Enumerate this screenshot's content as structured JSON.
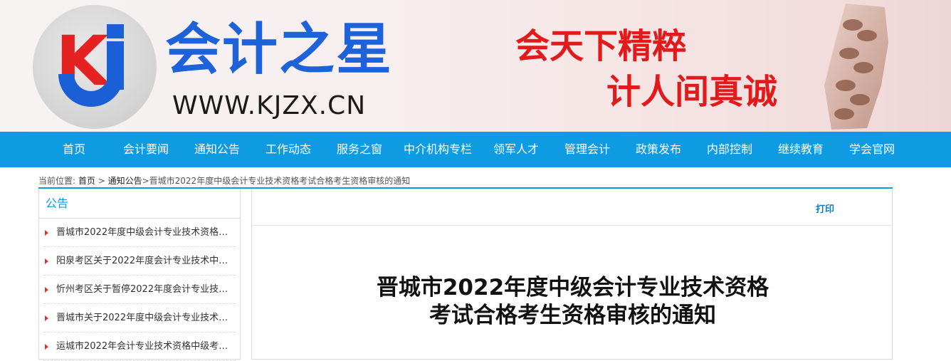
{
  "header": {
    "logo_text": "Kj",
    "site_name": "会计之星",
    "site_url": "WWW.KJZX.CN",
    "slogan_line1": "会天下精粹",
    "slogan_line2": "计人间真诚",
    "brand_blue": "#1d62d8",
    "slogan_red": "#e11b1b"
  },
  "nav": {
    "color": "#0e9be2",
    "items": [
      {
        "label": "首页"
      },
      {
        "label": "会计要闻"
      },
      {
        "label": "通知公告"
      },
      {
        "label": "工作动态"
      },
      {
        "label": "服务之窗"
      },
      {
        "label": "中介机构专栏"
      },
      {
        "label": "领军人才"
      },
      {
        "label": "管理会计"
      },
      {
        "label": "政策发布"
      },
      {
        "label": "内部控制"
      },
      {
        "label": "继续教育"
      },
      {
        "label": "学会官网"
      }
    ]
  },
  "breadcrumb": {
    "prefix": "当前位置:",
    "home": "首页",
    "sep1": " > ",
    "section": "通知公告",
    "sep2": ">",
    "current": "晋城市2022年度中级会计专业技术资格考试合格考生资格审核的通知"
  },
  "sidebar": {
    "title": "公告",
    "items": [
      {
        "label": "晋城市2022年度中级会计专业技术资格考..."
      },
      {
        "label": "阳泉考区关于2022年度会计专业技术中级..."
      },
      {
        "label": "忻州考区关于暂停2022年度会计专业技术..."
      },
      {
        "label": "晋城市关于2022年度中级会计专业技术资..."
      },
      {
        "label": "运城市2022年会计专业技术资格中级考试..."
      }
    ]
  },
  "article": {
    "print_label": "打印",
    "title_line1": "晋城市2022年度中级会计专业技术资格",
    "title_line2": "考试合格考生资格审核的通知"
  }
}
